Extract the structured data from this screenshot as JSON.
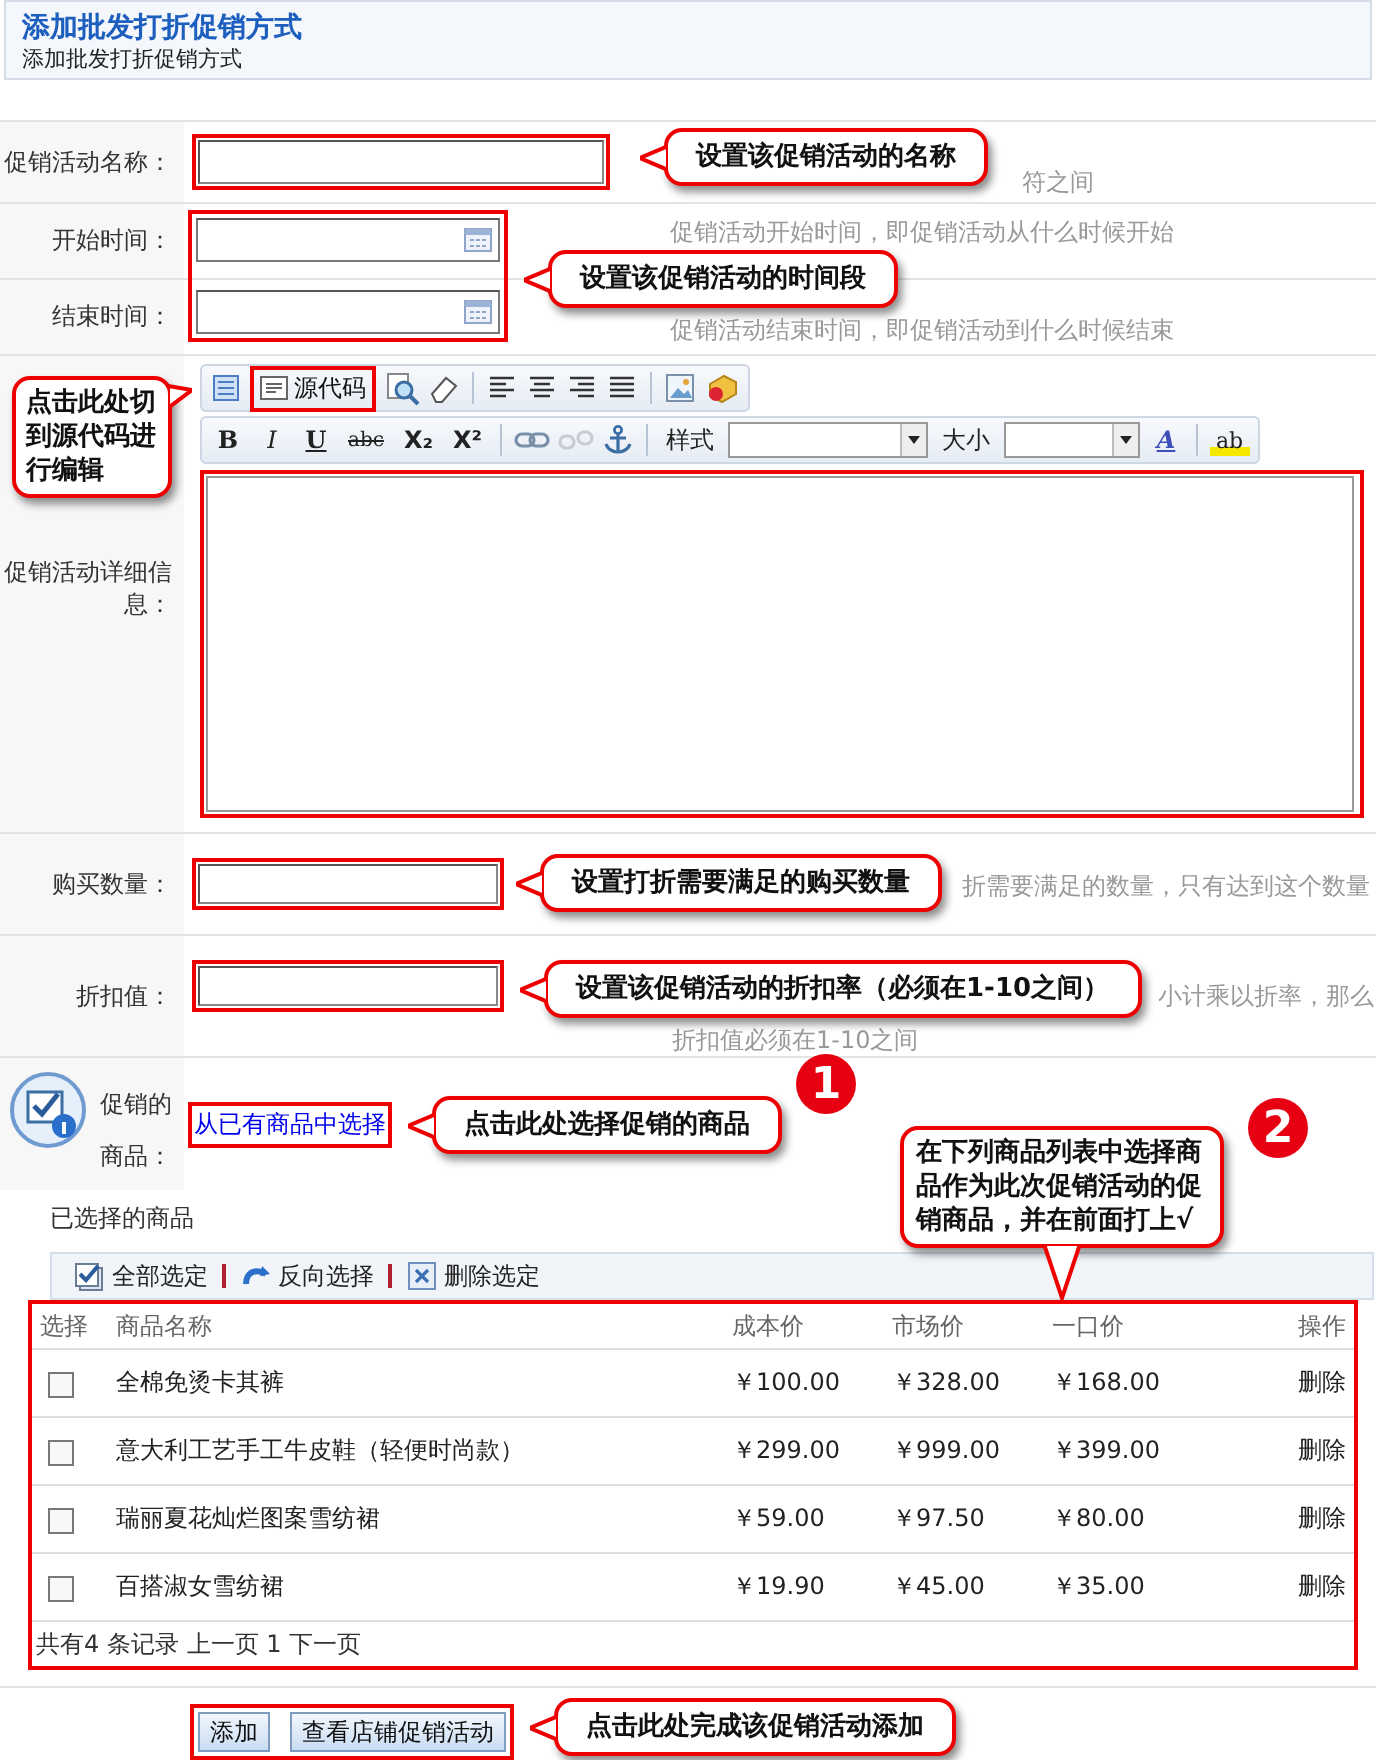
{
  "page_header": {
    "title": "添加批发打折促销方式",
    "subtitle": "添加批发打折促销方式"
  },
  "name_row": {
    "label": "促销活动名称：",
    "hint": "符之间",
    "callout": "设置该促销活动的名称"
  },
  "time_rows": {
    "callout": "设置该促销活动的时间段",
    "rows": [
      {
        "label": "开始时间：",
        "hint": "促销活动开始时间，即促销活动从什么时候开始"
      },
      {
        "label": "结束时间：",
        "hint": "促销活动结束时间，即促销活动到什么时候结束"
      }
    ]
  },
  "editor": {
    "label": "促销活动详细信息：",
    "callout": "点击此处切到源代码进行编辑",
    "source_button": "源代码",
    "format_buttons": [
      "B",
      "I",
      "U",
      "abc",
      "X₂",
      "X²"
    ],
    "style_label": "样式",
    "size_label": "大小",
    "font_color_button": "A",
    "highlight_button": "ab"
  },
  "quantity_row": {
    "label": "购买数量：",
    "hint": "折需要满足的数量，只有达到这个数量",
    "callout": "设置打折需要满足的购买数量"
  },
  "discount_row": {
    "label": "折扣值：",
    "hints": [
      "小计乘以折率，那么",
      "折扣值必须在1-10之间"
    ],
    "callout": "设置该促销活动的折扣率（必须在1-10之间）"
  },
  "products": {
    "label": "促销的商品：",
    "link": "从已有商品中选择",
    "callout": "点击此处选择促销的商品",
    "step_1": "1",
    "step_2": "2",
    "table_callout": "在下列商品列表中选择商品作为此次促销活动的促销商品，并在前面打上√",
    "selected_title": "已选择的商品",
    "actions": [
      "全部选定",
      "反向选择",
      "删除选定"
    ]
  },
  "table": {
    "columns": [
      "选择",
      "商品名称",
      "成本价",
      "市场价",
      "一口价",
      "操作"
    ],
    "rows": [
      {
        "checked": false,
        "name": "全棉免烫卡其裤",
        "cost": "￥100.00",
        "market": "￥328.00",
        "price": "￥168.00",
        "action": "删除"
      },
      {
        "checked": false,
        "name": "意大利工艺手工牛皮鞋（轻便时尚款）",
        "cost": "￥299.00",
        "market": "￥999.00",
        "price": "￥399.00",
        "action": "删除"
      },
      {
        "checked": false,
        "name": "瑞丽夏花灿烂图案雪纺裙",
        "cost": "￥59.00",
        "market": "￥97.50",
        "price": "￥80.00",
        "action": "删除"
      },
      {
        "checked": false,
        "name": "百搭淑女雪纺裙",
        "cost": "￥19.90",
        "market": "￥45.00",
        "price": "￥35.00",
        "action": "删除"
      }
    ],
    "footer": "共有4 条记录  上一页 1 下一页"
  },
  "buttons": [
    "添加",
    "查看店铺促销活动"
  ],
  "final_callout": "点击此处完成该促销活动添加"
}
